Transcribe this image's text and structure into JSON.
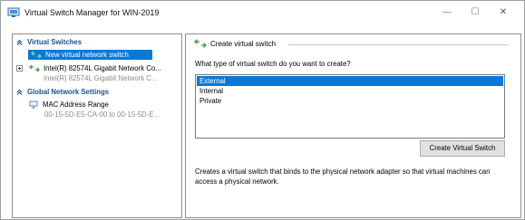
{
  "window": {
    "title": "Virtual Switch Manager for WIN-2019",
    "minimize_glyph": "—",
    "maximize_glyph": "☐",
    "close_glyph": "✕"
  },
  "tree": {
    "virtual_switches_header": "Virtual Switches",
    "new_switch": "New virtual network switch",
    "switch_name": "Intel(R) 82574L Gigabit Network Co...",
    "switch_detail": "Intel(R) 82574L Gigabit Network C...",
    "global_settings_header": "Global Network Settings",
    "mac_range_label": "MAC Address Range",
    "mac_range_value": "00-15-5D-E5-CA-00 to 00-15-5D-E..."
  },
  "panel": {
    "group_title": "Create virtual switch",
    "question": "What type of virtual switch do you want to create?",
    "options": [
      "External",
      "Internal",
      "Private"
    ],
    "selected_option": "External",
    "create_button": "Create Virtual Switch",
    "description": "Creates a virtual switch that binds to the physical network adapter so that virtual machines can access a physical network."
  },
  "colors": {
    "selection": "#0a78d7",
    "section_header": "#1d4f91",
    "switch_icon_green": "#3a9a3a"
  },
  "icons": {
    "app": "virtual-switch-manager-icon",
    "section_collapse": "collapse-chevron-icon",
    "switch": "network-switch-icon",
    "expand": "expand-plus-icon"
  }
}
